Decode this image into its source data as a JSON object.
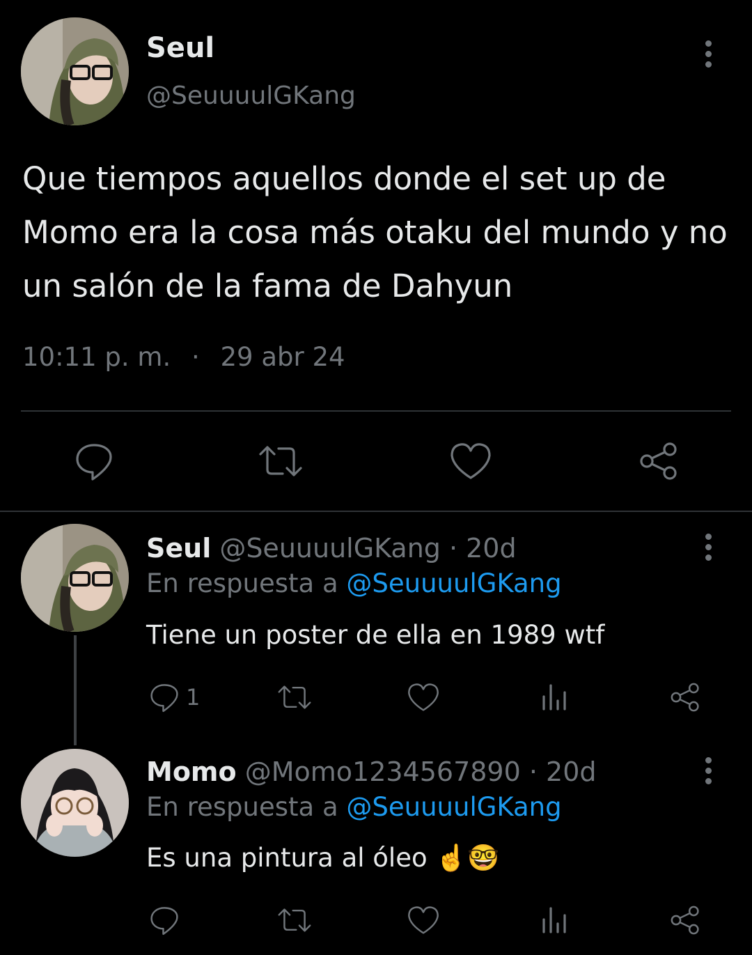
{
  "main_tweet": {
    "display_name": "Seul",
    "handle": "@SeuuuulGKang",
    "text": "Que tiempos aquellos donde el set up de Momo era la cosa más otaku del mundo y no un salón de la fama de Dahyun",
    "time": "10:11 p. m.",
    "separator": "·",
    "date": "29 abr 24"
  },
  "replies": [
    {
      "display_name": "Seul",
      "meta": "@SeuuuulGKang · 20d",
      "reply_prefix": "En respuesta a",
      "reply_to": "@SeuuuulGKang",
      "text": "Tiene un poster de ella en 1989 wtf",
      "reply_count": "1"
    },
    {
      "display_name": "Momo",
      "meta": "@Momo1234567890 · 20d",
      "reply_prefix": "En respuesta a",
      "reply_to": "@SeuuuulGKang",
      "text": "Es una pintura al óleo ☝️🤓",
      "reply_count": ""
    }
  ],
  "colors": {
    "background": "#000000",
    "text": "#e7e9ea",
    "muted": "#71767b",
    "link": "#1d9bf0",
    "divider": "#2f3336"
  },
  "icons": [
    "reply-icon",
    "retweet-icon",
    "like-icon",
    "share-icon",
    "views-icon",
    "more-icon"
  ]
}
